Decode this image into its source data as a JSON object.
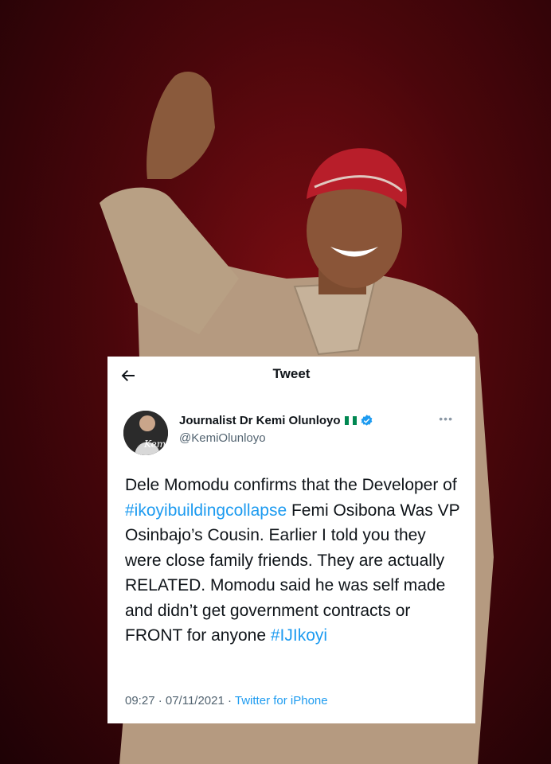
{
  "header": {
    "title": "Tweet"
  },
  "author": {
    "name": "Journalist Dr Kemi Olunloyo",
    "handle": "@KemiOlunloyo",
    "avatar_text": "Kemi"
  },
  "tweet": {
    "text_1": "Dele Momodu confirms that the Developer of ",
    "hashtag_1": "#ikoyibuildingcollapse",
    "text_2": " Femi Osibona Was VP Osinbajo’s Cousin. Earlier I told you they were close family friends. They are actually RELATED. Momodu said he was self made and didn’t get government contracts or FRONT for anyone ",
    "hashtag_2": "#IJIkoyi"
  },
  "meta": {
    "time_date": "09:27 · 07/11/2021 · ",
    "source": "Twitter for iPhone"
  },
  "icons": [
    "back-arrow-icon",
    "nigeria-flag-icon",
    "verified-badge-icon",
    "more-options-icon"
  ],
  "colors": {
    "link": "#1d9bf0",
    "text": "#0f1419",
    "secondary": "#536471",
    "background": "#4a060b",
    "flag_green": "#008751"
  }
}
